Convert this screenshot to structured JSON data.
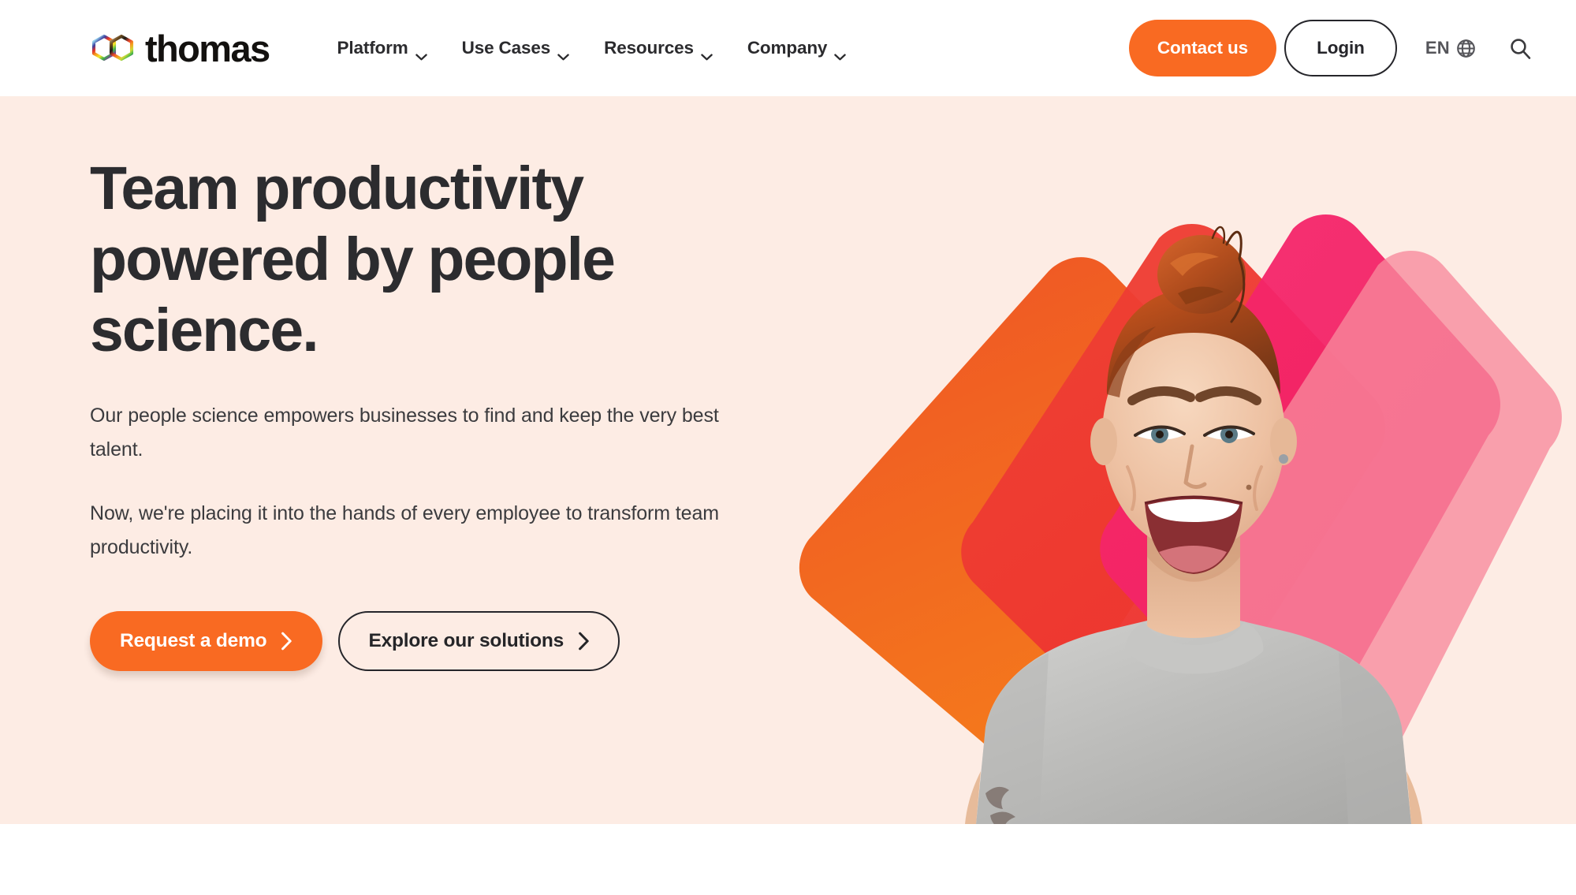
{
  "brand": {
    "name": "thomas",
    "logo_icon": "interlocking-hexagons-rainbow-logo"
  },
  "header": {
    "nav_items": [
      {
        "label": "Platform",
        "icon": "chevron-down-icon"
      },
      {
        "label": "Use Cases",
        "icon": "chevron-down-icon"
      },
      {
        "label": "Resources",
        "icon": "chevron-down-icon"
      },
      {
        "label": "Company",
        "icon": "chevron-down-icon"
      }
    ],
    "contact_label": "Contact us",
    "login_label": "Login",
    "language_label": "EN",
    "language_icon": "globe-icon",
    "search_icon": "search-icon"
  },
  "hero": {
    "title": "Team productivity powered by people science.",
    "paragraph_1": "Our people science empowers businesses to find and keep the very best talent.",
    "paragraph_2": "Now, we're placing it into the hands of every employee to transform team productivity.",
    "cta_primary": "Request a demo",
    "cta_primary_icon": "chevron-right-icon",
    "cta_secondary": "Explore our solutions",
    "cta_secondary_icon": "chevron-right-icon",
    "image_alt": "Laughing woman with red hair in a top bun wearing a grey t-shirt"
  },
  "colors": {
    "brand_orange": "#f96a22",
    "hero_background": "#fdece4",
    "text_dark": "#2c2c2f",
    "shape_orange": "#f2621f",
    "shape_red": "#ee3f35",
    "shape_magenta": "#f62a69",
    "shape_pink": "#f6899b"
  }
}
